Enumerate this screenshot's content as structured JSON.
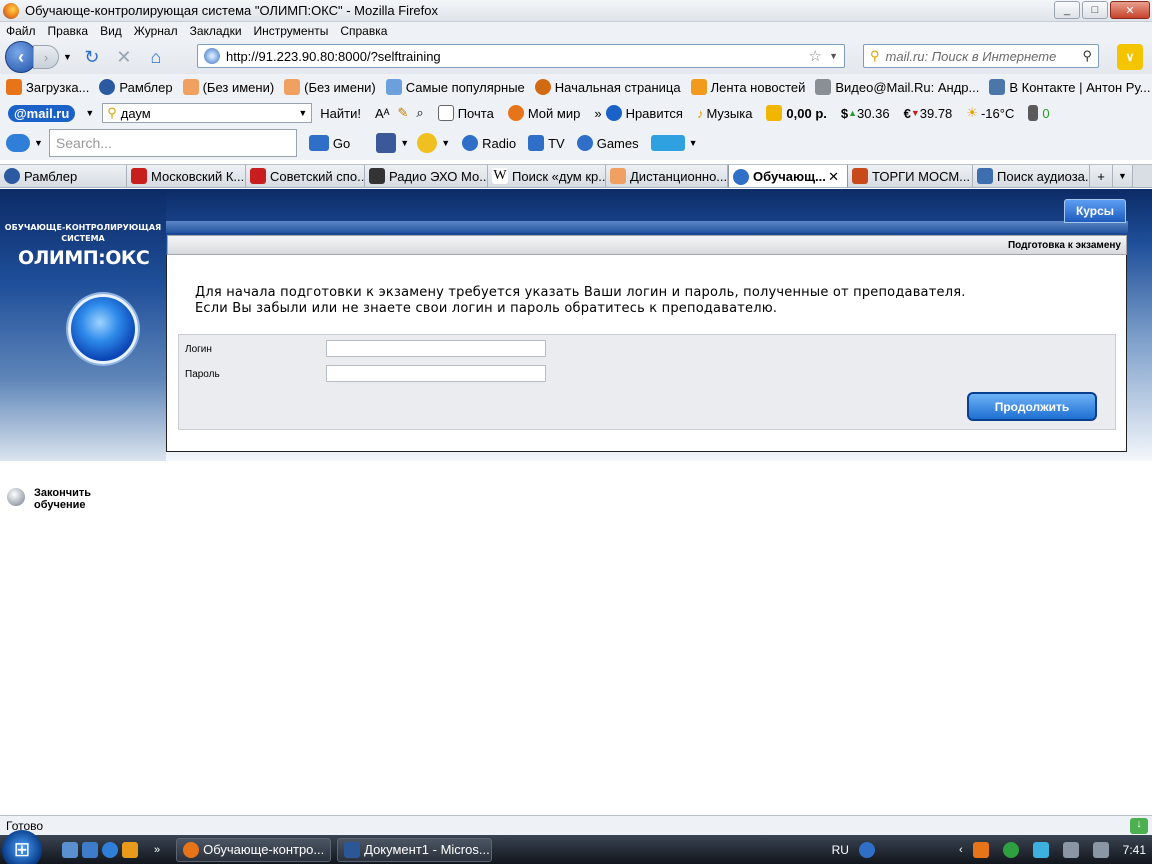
{
  "window": {
    "title": "Обучающе-контролирующая система \"ОЛИМП:ОКС\" - Mozilla Firefox",
    "minimize": "_",
    "maximize": "□",
    "close": "✕"
  },
  "menu": [
    "Файл",
    "Правка",
    "Вид",
    "Журнал",
    "Закладки",
    "Инструменты",
    "Справка"
  ],
  "nav": {
    "url": "http://91.223.90.80:8000/?selftraining",
    "search_placeholder": "mail.ru: Поиск в Интернете"
  },
  "bookmarks": [
    "Загрузка...",
    "Рамблер",
    "(Без имени)",
    "(Без имени)",
    "Самые популярные",
    "Начальная страница",
    "Лента новостей",
    "Видео@Mail.Ru: Андр...",
    "В Контакте | Антон Ру..."
  ],
  "mailru": {
    "logo": "@mail.ru",
    "query": "даум",
    "find": "Найти!",
    "mail": "Почта",
    "myworld": "Мой мир",
    "like": "Нравится",
    "music": "Музыка",
    "balance": "0,00 р.",
    "usd": "30.36",
    "eur": "39.78",
    "temp": "-16°C",
    "count": "0"
  },
  "toolbar4": {
    "search_placeholder": "Search...",
    "go": "Go",
    "radio": "Radio",
    "tv": "TV",
    "games": "Games"
  },
  "tabs": [
    {
      "label": "Рамблер"
    },
    {
      "label": "Московский К..."
    },
    {
      "label": "Советский спо..."
    },
    {
      "label": "Радио ЭХО Мо..."
    },
    {
      "label": "Поиск «дум кр..."
    },
    {
      "label": "Дистанционно..."
    },
    {
      "label": "Обучающ..."
    },
    {
      "label": "ТОРГИ МОСМ..."
    },
    {
      "label": "Поиск аудиоза..."
    }
  ],
  "site": {
    "system_title": "ОБУЧАЮЩЕ-КОНТРОЛИРУЮЩАЯ СИСТЕМА",
    "logo": "ОЛИМП:ОКС",
    "courses": "Курсы",
    "section": "Подготовка к экзамену",
    "message1": "Для начала подготовки к экзамену требуется указать Ваши логин и пароль, полученные от преподавателя.",
    "message2": "Если Вы забыли или не знаете свои логин и пароль обратитесь к преподавателю.",
    "login_label": "Логин",
    "password_label": "Пароль",
    "login_value": "",
    "password_value": "",
    "continue": "Продолжить",
    "finish": "Закончить обучение"
  },
  "status": "Готово",
  "taskbar": {
    "items": [
      "Обучающе-контро...",
      "Документ1 - Micros..."
    ],
    "lang": "RU",
    "time": "7:41"
  }
}
